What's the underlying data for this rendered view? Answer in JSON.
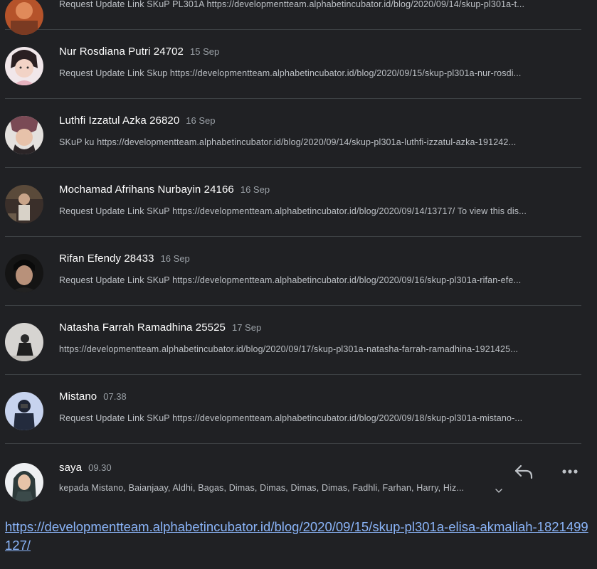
{
  "messages": [
    {
      "sender": "",
      "date": "",
      "snippet": "Request Update Link SKuP PL301A https://developmentteam.alphabetincubator.id/blog/2020/09/14/skup-pl301a-t...",
      "avatar": "avatar-orange"
    },
    {
      "sender": "Nur Rosdiana Putri 24702",
      "date": "15 Sep",
      "snippet": "Request Update Link Skup https://developmentteam.alphabetincubator.id/blog/2020/09/15/skup-pl301a-nur-rosdi...",
      "avatar": "avatar-pink"
    },
    {
      "sender": "Luthfi Izzatul Azka 26820",
      "date": "16 Sep",
      "snippet": "SKuP ku https://developmentteam.alphabetincubator.id/blog/2020/09/14/skup-pl301a-luthfi-izzatul-azka-191242...",
      "avatar": "avatar-upside"
    },
    {
      "sender": "Mochamad Afrihans Nurbayin 24166",
      "date": "16 Sep",
      "snippet": "Request Update Link SKuP https://developmentteam.alphabetincubator.id/blog/2020/09/14/13717/ To view this dis...",
      "avatar": "avatar-dark-street"
    },
    {
      "sender": "Rifan Efendy 28433",
      "date": "16 Sep",
      "snippet": "Request Update Link SKuP https://developmentteam.alphabetincubator.id/blog/2020/09/16/skup-pl301a-rifan-efe...",
      "avatar": "avatar-dark-portrait"
    },
    {
      "sender": "Natasha Farrah Ramadhina 25525",
      "date": "17 Sep",
      "snippet": "https://developmentteam.alphabetincubator.id/blog/2020/09/17/skup-pl301a-natasha-farrah-ramadhina-1921425...",
      "avatar": "avatar-grey-hijab"
    },
    {
      "sender": "Mistano",
      "date": "07.38",
      "snippet": "Request Update Link SKuP https://developmentteam.alphabetincubator.id/blog/2020/09/18/skup-pl301a-mistano-...",
      "avatar": "avatar-blue-camera"
    }
  ],
  "open_message": {
    "sender": "saya",
    "date": "09.30",
    "recipients": "kepada Mistano, Baianjaay, Aldhi, Bagas, Dimas, Dimas, Dimas, Dimas, Fadhli, Farhan, Harry, Hiz...",
    "avatar": "avatar-hijab-light",
    "body_link": "https://developmentteam.alphabetincubator.id/blog/2020/09/15/skup-pl301a-elisa-akmaliah-1821499127/"
  },
  "icons": {
    "reply": "reply-icon",
    "more": "more-horizontal-icon",
    "expand": "chevron-down-icon"
  },
  "colors": {
    "background": "#202124",
    "divider": "#3c4043",
    "link": "#8ab4f8",
    "sender": "#ffffff",
    "meta": "#9aa0a6"
  }
}
